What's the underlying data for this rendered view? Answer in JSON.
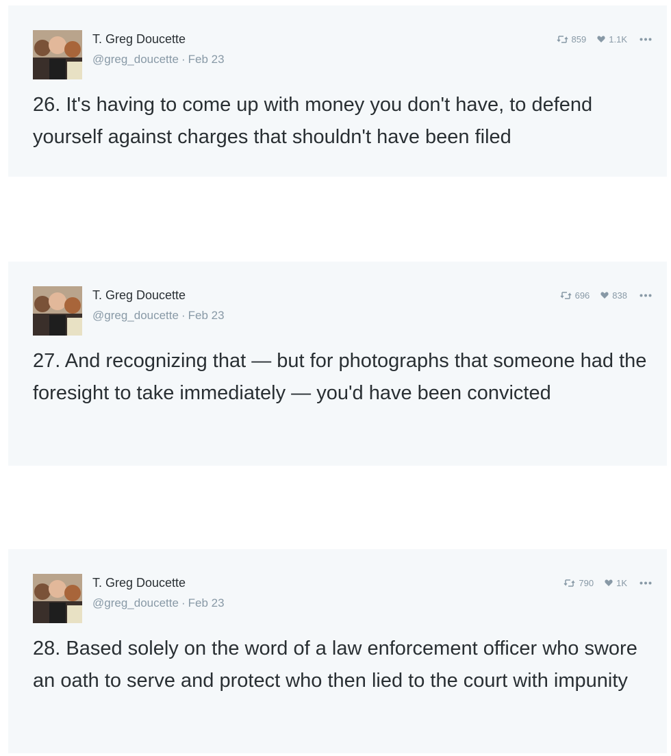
{
  "tweets": [
    {
      "author": {
        "name": "T. Greg Doucette",
        "handle": "@greg_doucette",
        "date": "Feb 23"
      },
      "stats": {
        "retweets": "859",
        "likes": "1.1K"
      },
      "text": "26. It's having to come up with money you don't have, to defend yourself against charges that shouldn't have been filed"
    },
    {
      "author": {
        "name": "T. Greg Doucette",
        "handle": "@greg_doucette",
        "date": "Feb 23"
      },
      "stats": {
        "retweets": "696",
        "likes": "838"
      },
      "text": "27. And recognizing that — but for photographs that someone had the foresight to take immediately — you'd have been convicted"
    },
    {
      "author": {
        "name": "T. Greg Doucette",
        "handle": "@greg_doucette",
        "date": "Feb 23"
      },
      "stats": {
        "retweets": "790",
        "likes": "1K"
      },
      "text": "28. Based solely on the word of a law enforcement officer who swore an oath to serve and protect who then lied to the court with impunity"
    }
  ],
  "icons": {
    "retweet": "retweet-icon",
    "like": "heart-icon",
    "more": "more-dots-icon"
  },
  "colors": {
    "card_background": "#f5f8fa",
    "text": "#292f33",
    "muted": "#8899a6"
  }
}
